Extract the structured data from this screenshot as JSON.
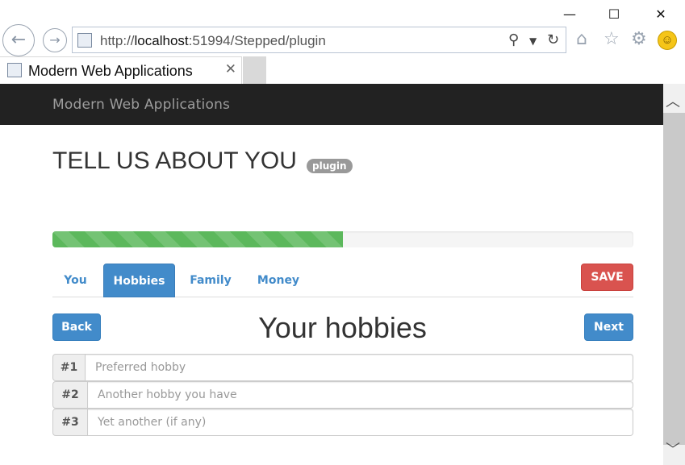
{
  "browser": {
    "url_prefix": "http://",
    "url_host": "localhost",
    "url_rest": ":51994/Stepped/plugin",
    "tab_title": "Modern Web Applications",
    "window_controls": {
      "minimize": "—",
      "maximize": "☐",
      "close": "✕"
    }
  },
  "navbar": {
    "brand": "Modern Web Applications"
  },
  "header": {
    "title": "TELL US ABOUT YOU",
    "badge": "plugin"
  },
  "progress": {
    "percent": 50,
    "color": "#5cb85c"
  },
  "tabs": [
    {
      "label": "You",
      "active": false
    },
    {
      "label": "Hobbies",
      "active": true
    },
    {
      "label": "Family",
      "active": false
    },
    {
      "label": "Money",
      "active": false
    }
  ],
  "actions": {
    "save_label": "SAVE",
    "back_label": "Back",
    "next_label": "Next"
  },
  "section": {
    "title": "Your hobbies"
  },
  "hobbies": [
    {
      "addon": "#1",
      "placeholder": "Preferred hobby",
      "value": ""
    },
    {
      "addon": "#2",
      "placeholder": "Another hobby you have",
      "value": ""
    },
    {
      "addon": "#3",
      "placeholder": "Yet another (if any)",
      "value": ""
    }
  ],
  "colors": {
    "primary": "#428bca",
    "danger": "#d9534f",
    "success": "#5cb85c",
    "navbar": "#222222"
  }
}
